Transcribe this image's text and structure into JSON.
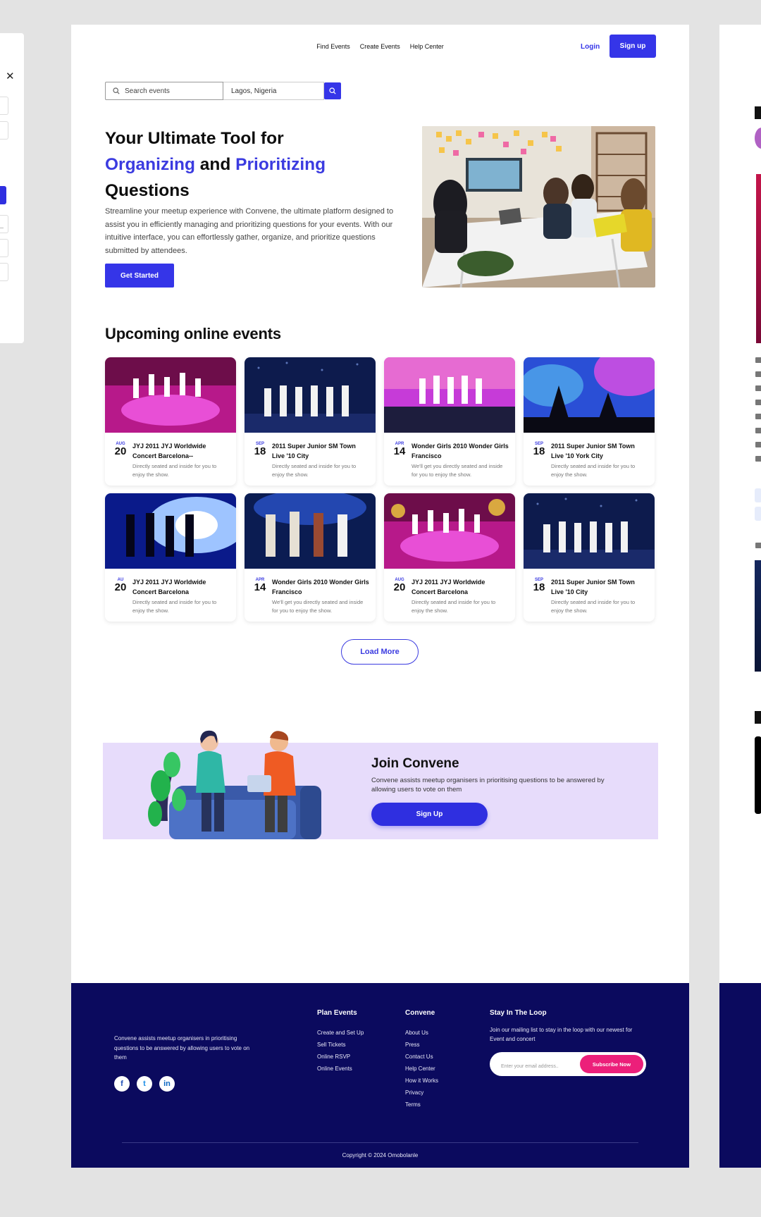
{
  "nav": {
    "links": [
      "Find Events",
      "Create Events",
      "Help Center"
    ],
    "login": "Login",
    "signup": "Sign up"
  },
  "search": {
    "placeholder": "Search events",
    "location": "Lagos, Nigeria"
  },
  "hero": {
    "title_line1": "Your Ultimate Tool for",
    "title_word1": "Organizing",
    "title_and": "and",
    "title_word2": "Prioritizing",
    "title_line3": "Questions",
    "description": "Streamline your meetup experience with Convene, the ultimate platform designed to assist you in efficiently managing and prioritizing questions for your events. With our intuitive interface, you can effortlessly gather, organize, and prioritize questions submitted by attendees.",
    "cta": "Get Started"
  },
  "events": {
    "section_title": "Upcoming online events",
    "items": [
      {
        "month": "AUG",
        "day": "20",
        "title": "JYJ 2011 JYJ Worldwide Concert Barcelona--",
        "desc": "Directly seated and inside for you to enjoy the show."
      },
      {
        "month": "SEP",
        "day": "18",
        "title": "2011 Super Junior SM Town Live '10 City",
        "desc": "Directly seated and inside for you to enjoy the show."
      },
      {
        "month": "APR",
        "day": "14",
        "title": "Wonder Girls 2010 Wonder Girls Francisco",
        "desc": "We'll get you directly seated and inside for you to enjoy the show."
      },
      {
        "month": "SEP",
        "day": "18",
        "title": "2011 Super Junior SM Town Live '10 York City",
        "desc": "Directly seated and inside for you to enjoy the show."
      },
      {
        "month": "AU",
        "day": "20",
        "title": "JYJ 2011 JYJ Worldwide Concert Barcelona",
        "desc": "Directly seated and inside for you to enjoy the show."
      },
      {
        "month": "APR",
        "day": "14",
        "title": "Wonder Girls 2010 Wonder Girls Francisco",
        "desc": "We'll get you directly seated and inside for you to enjoy the show."
      },
      {
        "month": "AUG",
        "day": "20",
        "title": "JYJ 2011 JYJ Worldwide Concert Barcelona",
        "desc": "Directly seated and inside for you to enjoy the show."
      },
      {
        "month": "SEP",
        "day": "18",
        "title": "2011 Super Junior SM Town Live '10 City",
        "desc": "Directly seated and inside for you to enjoy the show."
      }
    ],
    "load_more": "Load More"
  },
  "join": {
    "title": "Join Convene",
    "description": "Convene assists meetup organisers in prioritising questions to be answered by allowing users to vote on them",
    "button": "Sign Up"
  },
  "footer": {
    "description": "Convene assists meetup organisers in prioritising questions to be answered by allowing users to vote on them",
    "social": [
      "facebook-icon",
      "twitter-icon",
      "linkedin-icon"
    ],
    "plan_events": {
      "title": "Plan Events",
      "links": [
        "Create and Set Up",
        "Sell Tickets",
        "Online RSVP",
        "Online Events"
      ]
    },
    "convene": {
      "title": "Convene",
      "links": [
        "About Us",
        "Press",
        "Contact Us",
        "Help Center",
        "How it Works",
        "Privacy",
        "Terms"
      ]
    },
    "loop": {
      "title": "Stay In The Loop",
      "description": "Join our mailing list to stay in the loop with our newest for Event and concert",
      "placeholder": "Enter your email address..",
      "button": "Subscribe Now"
    },
    "copyright": "Copyright © 2024 Omobolanle"
  },
  "colors": {
    "accent": "#3535e8",
    "footer_bg": "#0b0a5e",
    "join_bg": "#e7dcfb",
    "subscribe": "#ec1f7a"
  }
}
